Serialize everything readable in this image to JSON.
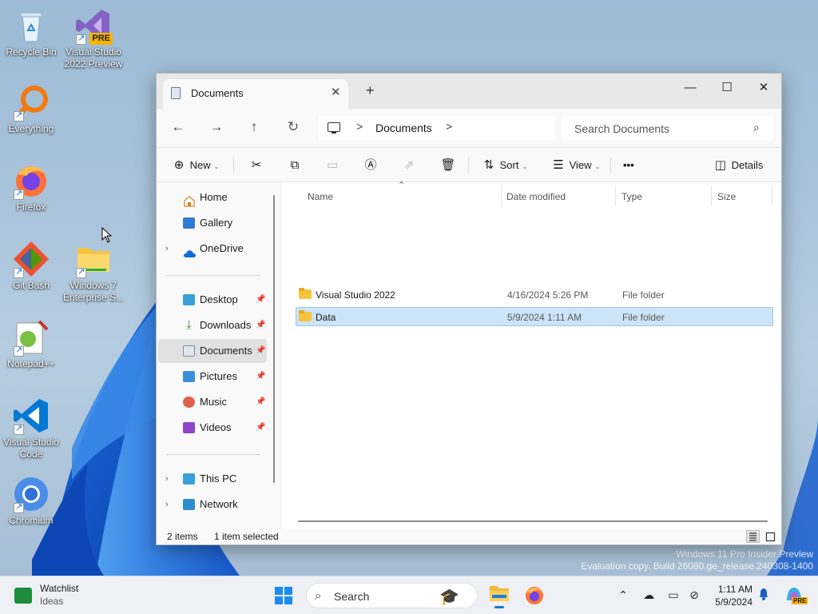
{
  "desktop": {
    "icons": [
      {
        "label_line1": "Recycle Bin",
        "label_line2": ""
      },
      {
        "label_line1": "Visual Studio",
        "label_line2": "2022 Preview",
        "badge": "PRE"
      },
      {
        "label_line1": "Everything",
        "label_line2": ""
      },
      {
        "label_line1": "Firefox",
        "label_line2": ""
      },
      {
        "label_line1": "Git Bash",
        "label_line2": ""
      },
      {
        "label_line1": "Windows 7",
        "label_line2": "Enterprise S..."
      },
      {
        "label_line1": "Notepad++",
        "label_line2": ""
      },
      {
        "label_line1": "Visual Studio",
        "label_line2": "Code"
      },
      {
        "label_line1": "Chromium",
        "label_line2": ""
      }
    ],
    "watermark_line1": "Windows 11 Pro Insider Preview",
    "watermark_line2": "Evaluation copy. Build 26080.ge_release.240308-1400"
  },
  "explorer": {
    "tab_title": "Documents",
    "tab_close": "✕",
    "new_tab": "+",
    "window_controls": {
      "minimize": "—",
      "maximize": "☐",
      "close": "✕"
    },
    "nav": {
      "back": "←",
      "forward": "→",
      "up": "↑",
      "refresh": "↻"
    },
    "address": {
      "separator": ">",
      "crumb": "Documents"
    },
    "search_placeholder": "Search Documents",
    "toolbar": {
      "new_label": "New",
      "sort_label": "Sort",
      "view_label": "View",
      "more_label": "•••",
      "details_label": "Details"
    },
    "sidebar": {
      "items": [
        {
          "label": "Home"
        },
        {
          "label": "Gallery"
        },
        {
          "label": "OneDrive"
        },
        {
          "label": "Desktop"
        },
        {
          "label": "Downloads"
        },
        {
          "label": "Documents"
        },
        {
          "label": "Pictures"
        },
        {
          "label": "Music"
        },
        {
          "label": "Videos"
        },
        {
          "label": "This PC"
        },
        {
          "label": "Network"
        }
      ],
      "selected": "Documents"
    },
    "columns": {
      "name": "Name",
      "date": "Date modified",
      "type": "Type",
      "size": "Size"
    },
    "files": [
      {
        "name": "Visual Studio 2022",
        "date": "4/16/2024 5:26 PM",
        "type": "File folder",
        "size": ""
      },
      {
        "name": "Data",
        "date": "5/9/2024 1:11 AM",
        "type": "File folder",
        "size": ""
      }
    ],
    "selected_file": "Data",
    "status": {
      "count": "2 items",
      "selection": "1 item selected"
    }
  },
  "taskbar": {
    "widget_title": "Watchlist",
    "widget_subtitle": "Ideas",
    "search_placeholder": "Search",
    "clock_time": "1:11 AM",
    "clock_date": "5/9/2024",
    "copilot_badge": "PRE"
  }
}
